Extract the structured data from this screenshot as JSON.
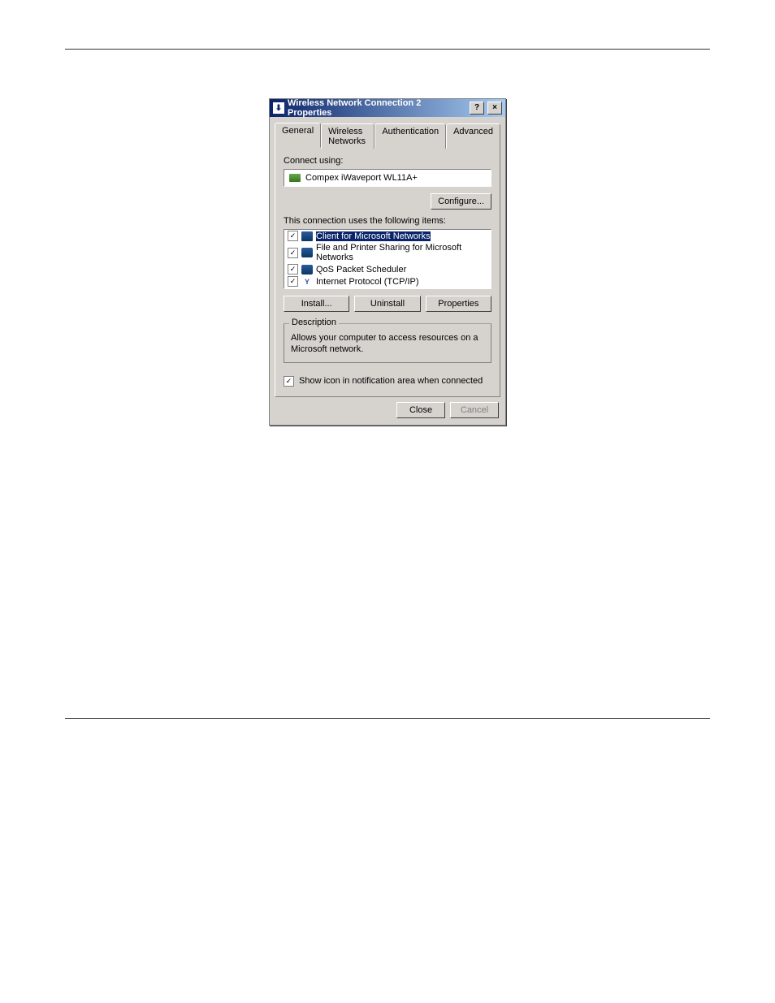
{
  "dialog": {
    "title": "Wireless Network Connection 2 Properties",
    "tabs": [
      "General",
      "Wireless Networks",
      "Authentication",
      "Advanced"
    ],
    "active_tab": 0,
    "connect_using_label": "Connect using:",
    "adapter": "Compex iWaveport WL11A+",
    "configure_btn": "Configure...",
    "items_label": "This connection uses the following items:",
    "items": [
      {
        "label": "Client for Microsoft Networks",
        "checked": true,
        "selected": true,
        "icon": "monitor"
      },
      {
        "label": "File and Printer Sharing for Microsoft Networks",
        "checked": true,
        "selected": false,
        "icon": "service"
      },
      {
        "label": "QoS Packet Scheduler",
        "checked": true,
        "selected": false,
        "icon": "service"
      },
      {
        "label": "Internet Protocol (TCP/IP)",
        "checked": true,
        "selected": false,
        "icon": "protocol"
      }
    ],
    "install_btn": "Install...",
    "uninstall_btn": "Uninstall",
    "properties_btn": "Properties",
    "description_label": "Description",
    "description_text": "Allows your computer to access resources on a Microsoft network.",
    "show_icon_label": "Show icon in notification area when connected",
    "show_icon_checked": true,
    "close_btn": "Close",
    "cancel_btn": "Cancel"
  }
}
